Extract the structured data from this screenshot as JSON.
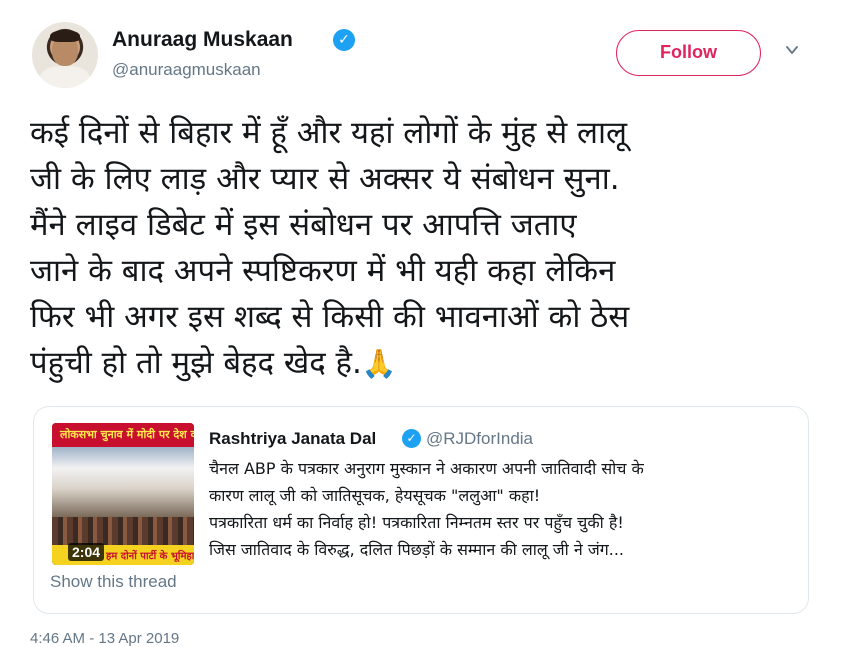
{
  "author": {
    "name": "Anuraag Muskaan",
    "handle": "@anuraagmuskaan",
    "verified_icon": "✓"
  },
  "follow_button": {
    "label": "Follow"
  },
  "tweet": {
    "lines": [
      "कई दिनों से बिहार में हूँ और यहां लोगों के मुंह से लालू",
      "जी के लिए लाड़ और प्यार से अक्सर ये संबोधन सुना.",
      "मैंने लाइव डिबेट में इस संबोधन पर आपत्ति जताए",
      "जाने के बाद अपने स्पष्टिकरण में भी यही कहा लेकिन",
      "फिर भी अगर इस शब्द से किसी की भावनाओं को ठेस",
      "पंहुची हो तो मुझे बेहद खेद है."
    ],
    "emoji": "🙏"
  },
  "quoted_tweet": {
    "name": "Rashtriya Janata Dal",
    "handle": "@RJDforIndia",
    "verified_icon": "✓",
    "lines": [
      "चैनल ABP के पत्रकार अनुराग मुस्कान ने अकारण अपनी जातिवादी सोच के",
      "कारण लालू जी को जातिसूचक, हेयसूचक \"ललुआ\" कहा!",
      "पत्रकारिता धर्म का निर्वाह हो! पत्रकारिता निम्नतम स्तर पर पहुँच चुकी है!",
      "जिस जातिवाद के विरुद्ध, दलित पिछड़ों के सम्मान की लालू जी ने जंग..."
    ],
    "thumbnail": {
      "banner": "लोकसभा चुनाव में मोदी पर देश व",
      "ticker": "हम दोनों पार्टी के भूमिहा",
      "duration": "2:04"
    },
    "show_thread": "Show this thread"
  },
  "timestamp": "4:46 AM - 13 Apr 2019",
  "colors": {
    "follow": "#e0245e",
    "verified": "#1da1f2",
    "secondary_text": "#657786",
    "border": "#e1e8ed"
  },
  "icons": {
    "verified": "verified-badge-icon",
    "chevron": "chevron-down-icon",
    "emoji": "folded-hands-icon"
  }
}
